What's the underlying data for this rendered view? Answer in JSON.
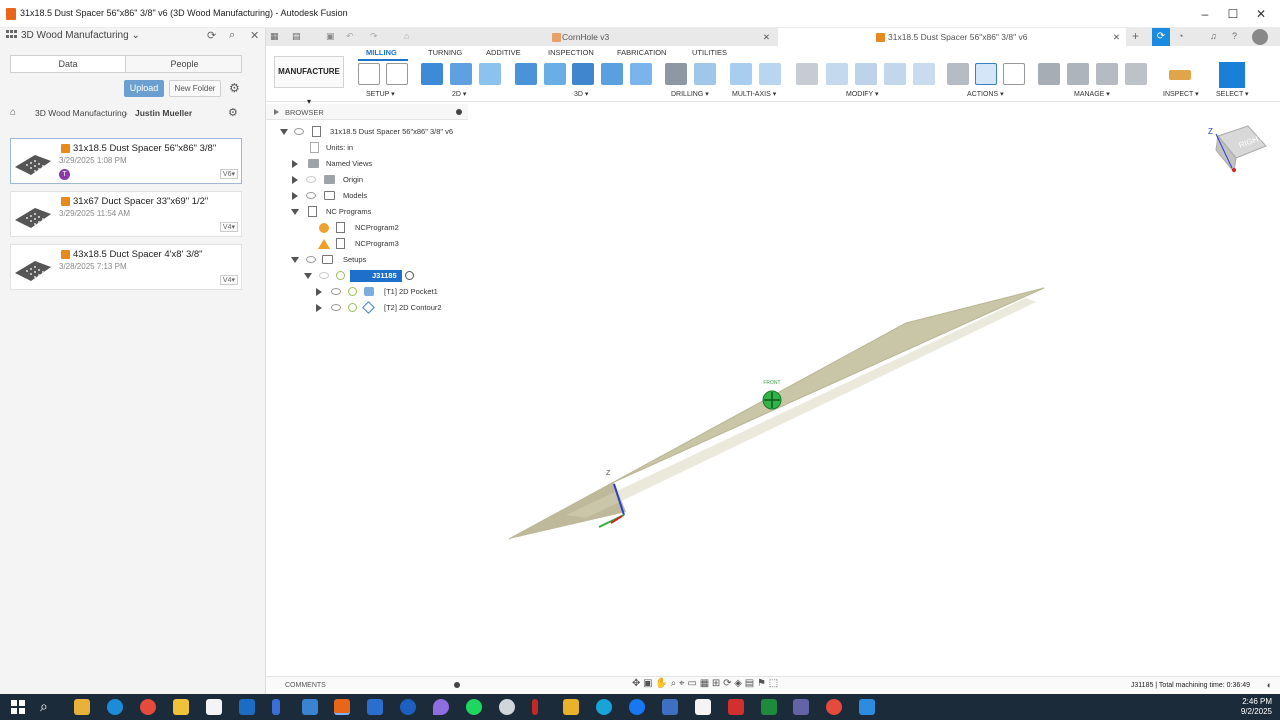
{
  "window": {
    "title": "31x18.5 Dust Spacer 56\"x86\" 3/8\" v6 (3D Wood Manufacturing) - Autodesk Fusion",
    "controls": [
      "–",
      "☐",
      "✕"
    ]
  },
  "data_panel": {
    "project": "3D Wood Manufacturing",
    "tabs": [
      "Data",
      "People"
    ],
    "upload_label": "Upload",
    "new_folder_label": "New Folder",
    "breadcrumb": [
      "3D Wood Manufacturing",
      "Justin Mueller"
    ],
    "files": [
      {
        "name": "31x18.5 Dust Spacer 56\"x86\" 3/8\"",
        "date": "3/29/2025 1:08 PM",
        "version": "V6",
        "badge": "T"
      },
      {
        "name": "31x67 Duct Spacer 33\"x69\" 1/2\"",
        "date": "3/29/2025 11:54 AM",
        "version": "V4",
        "badge": ""
      },
      {
        "name": "43x18.5 Duct Spacer 4'x8' 3/8\"",
        "date": "3/28/2025 7:13 PM",
        "version": "V4",
        "badge": ""
      }
    ]
  },
  "doc_tabs": [
    {
      "label": "CornHole v3",
      "active": false
    },
    {
      "label": "31x18.5 Dust Spacer 56\"x86\" 3/8\" v6",
      "active": true
    }
  ],
  "toolbar": {
    "workspace": "MANUFACTURE",
    "tabs": [
      "MILLING",
      "TURNING",
      "ADDITIVE",
      "INSPECTION",
      "FABRICATION",
      "UTILITIES"
    ],
    "active_tab": "MILLING",
    "groups": [
      "SETUP",
      "2D",
      "3D",
      "DRILLING",
      "MULTI-AXIS",
      "MODIFY",
      "ACTIONS",
      "MANAGE",
      "INSPECT",
      "SELECT"
    ],
    "accent": "#1a73c9"
  },
  "browser": {
    "header": "BROWSER",
    "root": "31x18.5 Dust Spacer 56\"x86\" 3/8\" v6",
    "units": "Units: in",
    "named_views": "Named Views",
    "origin": "Origin",
    "models": "Models",
    "nc_programs": "NC Programs",
    "nc1": "NCProgram2",
    "nc2": "NCProgram3",
    "setups": "Setups",
    "setup": "J31185",
    "op1": "[T1] 2D Pocket1",
    "op2": "[T2] 2D Contour2"
  },
  "viewcube": {
    "face": "RIGHT",
    "axis": "Z"
  },
  "viewport": {
    "axis_z": "Z",
    "origin_label": "FRONT"
  },
  "comments_label": "COMMENTS",
  "status": "J31185 | Total machining time: 0:36:49",
  "clock": {
    "time": "2:46 PM",
    "date": "9/2/2025"
  }
}
